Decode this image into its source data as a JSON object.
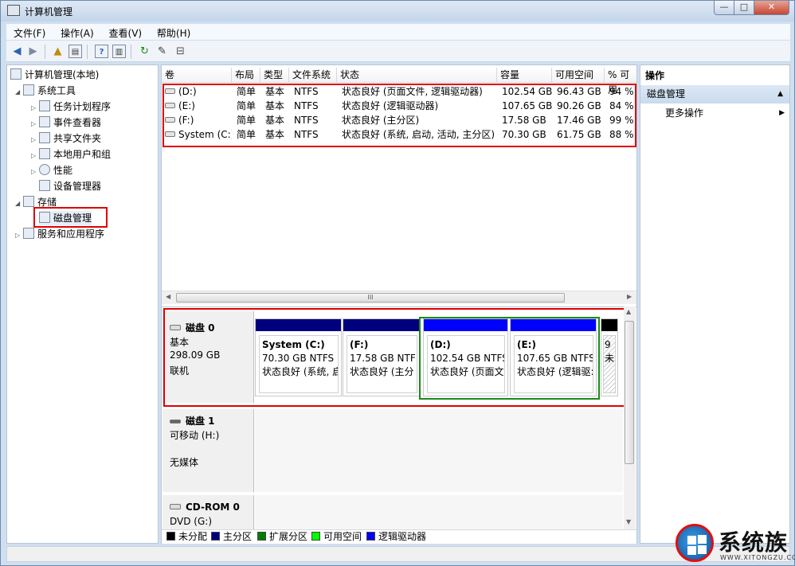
{
  "window": {
    "title": "计算机管理",
    "min": "—",
    "max": "□",
    "close": "✕"
  },
  "menu": [
    "文件(F)",
    "操作(A)",
    "查看(V)",
    "帮助(H)"
  ],
  "toolbar": {
    "back_icon": "back-arrow-icon",
    "forward_icon": "forward-arrow-icon"
  },
  "tree": {
    "root": "计算机管理(本地)",
    "system_tools": "系统工具",
    "task_scheduler": "任务计划程序",
    "event_viewer": "事件查看器",
    "shared_folders": "共享文件夹",
    "local_users": "本地用户和组",
    "performance": "性能",
    "device_manager": "设备管理器",
    "storage": "存储",
    "disk_management": "磁盘管理",
    "services": "服务和应用程序"
  },
  "volume_table": {
    "headers": [
      "卷",
      "布局",
      "类型",
      "文件系统",
      "状态",
      "容量",
      "可用空间",
      "% 可用"
    ],
    "rows": [
      [
        "(D:)",
        "简单",
        "基本",
        "NTFS",
        "状态良好 (页面文件, 逻辑驱动器)",
        "102.54 GB",
        "96.43 GB",
        "94 %"
      ],
      [
        "(E:)",
        "简单",
        "基本",
        "NTFS",
        "状态良好 (逻辑驱动器)",
        "107.65 GB",
        "90.26 GB",
        "84 %"
      ],
      [
        "(F:)",
        "简单",
        "基本",
        "NTFS",
        "状态良好 (主分区)",
        "17.58 GB",
        "17.46 GB",
        "99 %"
      ],
      [
        "System (C:)",
        "简单",
        "基本",
        "NTFS",
        "状态良好 (系统, 启动, 活动, 主分区)",
        "70.30 GB",
        "61.75 GB",
        "88 %"
      ]
    ]
  },
  "scroll": {
    "grip": "III"
  },
  "disks": {
    "disk0": {
      "name": "磁盘 0",
      "type": "基本",
      "size": "298.09 GB",
      "status": "联机"
    },
    "disk1": {
      "name": "磁盘 1",
      "type": "可移动 (H:)",
      "status": "无媒体"
    },
    "cdrom0": {
      "name": "CD-ROM 0",
      "type": "DVD (G:)"
    }
  },
  "partitions": [
    {
      "name": "System  (C:)",
      "size": "70.30 GB NTFS",
      "status": "状态良好 (系统, 启",
      "bar_color": "#00007f"
    },
    {
      "name": "(F:)",
      "size": "17.58 GB NTF",
      "status": "状态良好 (主分",
      "bar_color": "#00007f"
    },
    {
      "name": "(D:)",
      "size": "102.54 GB NTFS",
      "status": "状态良好 (页面文",
      "bar_color": "#0000ff"
    },
    {
      "name": "(E:)",
      "size": "107.65 GB NTFS",
      "status": "状态良好 (逻辑驱:",
      "bar_color": "#0000ff"
    },
    {
      "name": "9",
      "size": "未",
      "status": "",
      "bar_color": "#000000"
    }
  ],
  "legend": [
    {
      "label": "未分配",
      "color": "#000000"
    },
    {
      "label": "主分区",
      "color": "#00007f"
    },
    {
      "label": "扩展分区",
      "color": "#008000"
    },
    {
      "label": "可用空间",
      "color": "#00ff00"
    },
    {
      "label": "逻辑驱动器",
      "color": "#0000ff"
    }
  ],
  "actions": {
    "header": "操作",
    "section": "磁盘管理",
    "more": "更多操作"
  },
  "watermark": {
    "text": "系统族",
    "url": "WWW.XITONGZU.COM"
  }
}
